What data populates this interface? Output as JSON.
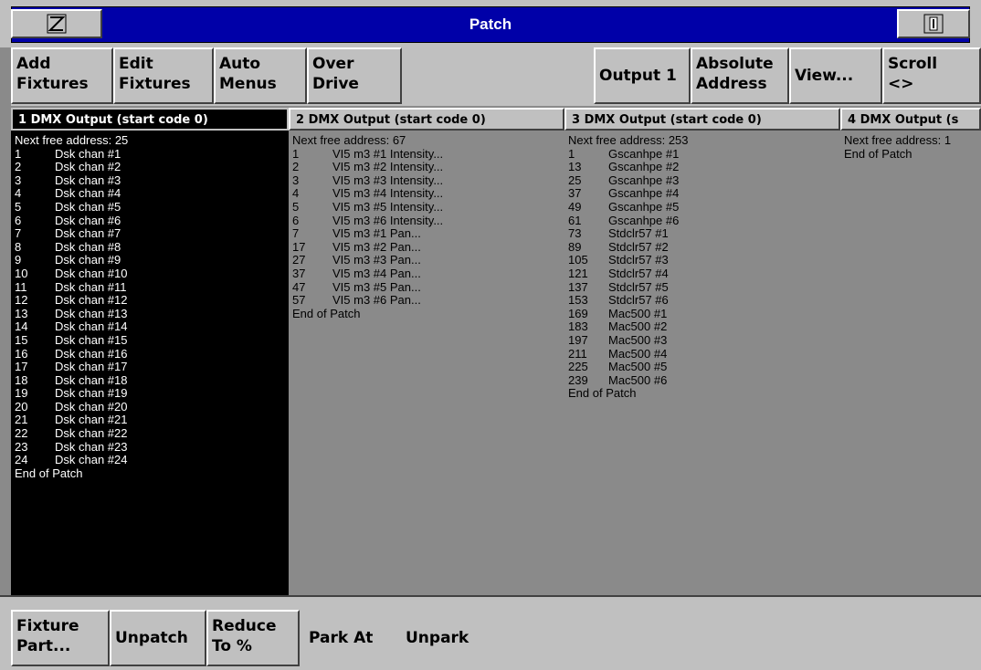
{
  "window": {
    "title": "Patch"
  },
  "toolbar": {
    "add_fixtures": "Add\nFixtures",
    "edit_fixtures": "Edit\nFixtures",
    "auto_menus": "Auto\nMenus",
    "over_drive": "Over\nDrive",
    "output": "Output 1",
    "absolute_address": "Absolute\nAddress",
    "view": "View...",
    "scroll": "Scroll\n<>"
  },
  "columns": [
    {
      "header": "1 DMX Output (start code 0)",
      "next_free": "Next free address: 25",
      "end": "End of Patch",
      "rows": [
        [
          "1",
          "Dsk chan #1"
        ],
        [
          "2",
          "Dsk chan #2"
        ],
        [
          "3",
          "Dsk chan #3"
        ],
        [
          "4",
          "Dsk chan #4"
        ],
        [
          "5",
          "Dsk chan #5"
        ],
        [
          "6",
          "Dsk chan #6"
        ],
        [
          "7",
          "Dsk chan #7"
        ],
        [
          "8",
          "Dsk chan #8"
        ],
        [
          "9",
          "Dsk chan #9"
        ],
        [
          "10",
          "Dsk chan #10"
        ],
        [
          "11",
          "Dsk chan #11"
        ],
        [
          "12",
          "Dsk chan #12"
        ],
        [
          "13",
          "Dsk chan #13"
        ],
        [
          "14",
          "Dsk chan #14"
        ],
        [
          "15",
          "Dsk chan #15"
        ],
        [
          "16",
          "Dsk chan #16"
        ],
        [
          "17",
          "Dsk chan #17"
        ],
        [
          "18",
          "Dsk chan #18"
        ],
        [
          "19",
          "Dsk chan #19"
        ],
        [
          "20",
          "Dsk chan #20"
        ],
        [
          "21",
          "Dsk chan #21"
        ],
        [
          "22",
          "Dsk chan #22"
        ],
        [
          "23",
          "Dsk chan #23"
        ],
        [
          "24",
          "Dsk chan #24"
        ]
      ]
    },
    {
      "header": "2 DMX Output (start code 0)",
      "next_free": "Next free address: 67",
      "end": "End of Patch",
      "rows": [
        [
          "1",
          "VI5 m3 #1 Intensity..."
        ],
        [
          "2",
          "VI5 m3 #2 Intensity..."
        ],
        [
          "3",
          "VI5 m3 #3 Intensity..."
        ],
        [
          "4",
          "VI5 m3 #4 Intensity..."
        ],
        [
          "5",
          "VI5 m3 #5 Intensity..."
        ],
        [
          "6",
          "VI5 m3 #6 Intensity..."
        ],
        [
          "7",
          "VI5 m3 #1 Pan..."
        ],
        [
          "17",
          "VI5 m3 #2 Pan..."
        ],
        [
          "27",
          "VI5 m3 #3 Pan..."
        ],
        [
          "37",
          "VI5 m3 #4 Pan..."
        ],
        [
          "47",
          "VI5 m3 #5 Pan..."
        ],
        [
          "57",
          "VI5 m3 #6 Pan..."
        ]
      ]
    },
    {
      "header": "3 DMX Output (start code 0)",
      "next_free": "Next free address: 253",
      "end": "End of Patch",
      "rows": [
        [
          "1",
          "Gscanhpe #1"
        ],
        [
          "13",
          "Gscanhpe #2"
        ],
        [
          "25",
          "Gscanhpe #3"
        ],
        [
          "37",
          "Gscanhpe #4"
        ],
        [
          "49",
          "Gscanhpe #5"
        ],
        [
          "61",
          "Gscanhpe #6"
        ],
        [
          "73",
          "Stdclr57 #1"
        ],
        [
          "89",
          "Stdclr57 #2"
        ],
        [
          "105",
          "Stdclr57 #3"
        ],
        [
          "121",
          "Stdclr57 #4"
        ],
        [
          "137",
          "Stdclr57 #5"
        ],
        [
          "153",
          "Stdclr57 #6"
        ],
        [
          "169",
          "Mac500 #1"
        ],
        [
          "183",
          "Mac500 #2"
        ],
        [
          "197",
          "Mac500 #3"
        ],
        [
          "211",
          "Mac500 #4"
        ],
        [
          "225",
          "Mac500 #5"
        ],
        [
          "239",
          "Mac500 #6"
        ]
      ]
    },
    {
      "header": "4 DMX Output (s",
      "next_free": "Next free address: 1",
      "end": "End of Patch",
      "rows": []
    }
  ],
  "bottom": {
    "fixture_part": "Fixture\nPart...",
    "unpatch": "Unpatch",
    "reduce_to": "Reduce\nTo %",
    "park_at": "Park At",
    "unpark": "Unpark"
  },
  "icons": {
    "left": "minimize-z-icon",
    "right": "scroll-bar-icon"
  }
}
